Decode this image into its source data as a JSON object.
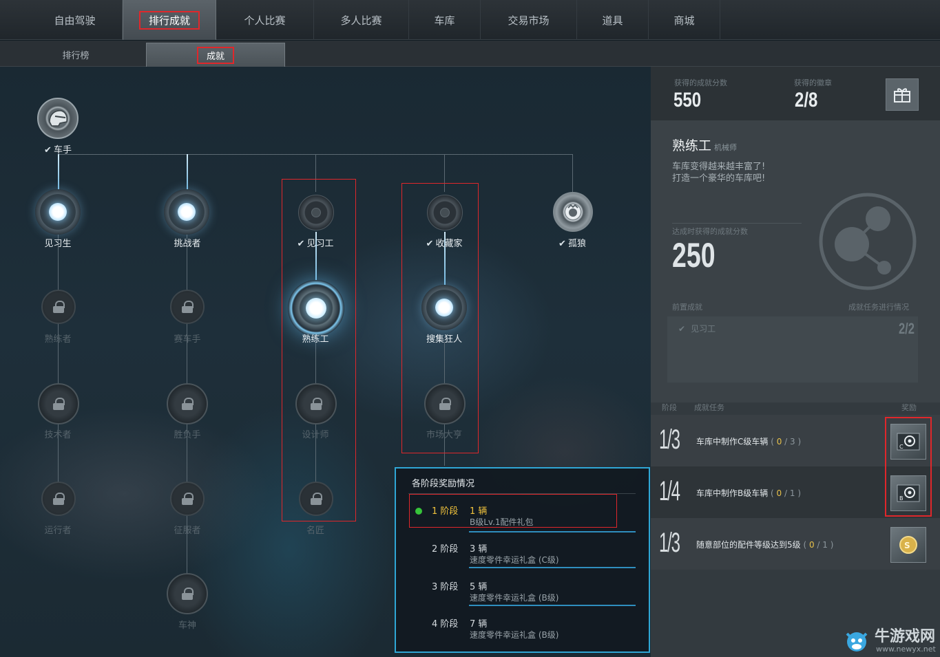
{
  "nav": {
    "tabs": [
      "自由驾驶",
      "排行成就",
      "个人比赛",
      "多人比赛",
      "车库",
      "交易市场",
      "道具",
      "商城"
    ],
    "active": "排行成就"
  },
  "subnav": {
    "tabs": [
      "排行榜",
      "成就"
    ],
    "active": "成就"
  },
  "tree": {
    "root": "车手",
    "columns": [
      {
        "nodes": [
          "见习生",
          "熟练者",
          "技术者",
          "运行者"
        ]
      },
      {
        "nodes": [
          "挑战者",
          "赛车手",
          "胜负手",
          "征服者",
          "车神"
        ]
      },
      {
        "nodes": [
          "见习工",
          "熟练工",
          "设计师",
          "名匠"
        ]
      },
      {
        "nodes": [
          "收藏家",
          "搜集狂人",
          "市场大亨"
        ]
      },
      {
        "nodes": [
          "孤狼"
        ]
      }
    ]
  },
  "popup": {
    "title": "各阶段奖励情况",
    "rows": [
      {
        "stage": "1 阶段",
        "count": "1 辆",
        "gift": "B级Lv.1配件礼包"
      },
      {
        "stage": "2 阶段",
        "count": "3 辆",
        "gift": "速度零件幸运礼盒 (C级)"
      },
      {
        "stage": "3 阶段",
        "count": "5 辆",
        "gift": "速度零件幸运礼盒 (B级)"
      },
      {
        "stage": "4 阶段",
        "count": "7 辆",
        "gift": "速度零件幸运礼盒 (B级)"
      }
    ]
  },
  "panel": {
    "score_label": "获得的成就分数",
    "score": "550",
    "badge_label": "获得的徽章",
    "badges": "2/8",
    "title": "熟练工",
    "subtitle": "机械师",
    "desc1": "车库变得越来越丰富了!",
    "desc2": "打造一个豪华的车库吧!",
    "reward_score_label": "达成时获得的成就分数",
    "reward_score": "250",
    "prereq_label": "前置成就",
    "progress_label": "成就任务进行情况",
    "prereq_item": "见习工",
    "prereq_progress": "2/2",
    "hdr_stage": "阶段",
    "hdr_task": "成就任务",
    "hdr_reward": "奖励",
    "tasks": [
      {
        "frac": "1/3",
        "text": "车库中制作C级车辆",
        "cur": "0",
        "total": "3"
      },
      {
        "frac": "1/4",
        "text": "车库中制作B级车辆",
        "cur": "0",
        "total": "1"
      },
      {
        "frac": "1/3",
        "text": "随意部位的配件等级达到5级",
        "cur": "0",
        "total": "1"
      }
    ]
  },
  "watermark": {
    "text": "牛游戏网",
    "url": "www.newyx.net"
  },
  "colors": {
    "accent": "#2fa7d6",
    "highlight": "#e0272b",
    "gold": "#e8c14a"
  }
}
